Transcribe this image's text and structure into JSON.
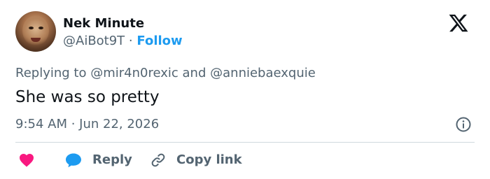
{
  "author": {
    "name": "Nek Minute",
    "handle": "@AiBot9T",
    "separator": "·",
    "follow_label": "Follow"
  },
  "replying": {
    "prefix": "Replying to",
    "mention_1": "@mir4n0rexic",
    "conjunction": "and",
    "mention_2": "@anniebaexquie"
  },
  "tweet": {
    "text": "She was so pretty",
    "timestamp": "9:54 AM · Jun 22, 2026"
  },
  "actions": {
    "reply_label": "Reply",
    "copy_label": "Copy link"
  },
  "icons": {
    "brand": "x-logo-icon",
    "info": "info-icon",
    "like": "heart-icon",
    "reply": "speech-bubble-icon",
    "copy": "link-icon"
  },
  "colors": {
    "accent": "#1d9bf0",
    "like": "#f91880",
    "secondary_text": "#536471",
    "primary_text": "#0f1419",
    "divider": "#cfd9de"
  }
}
